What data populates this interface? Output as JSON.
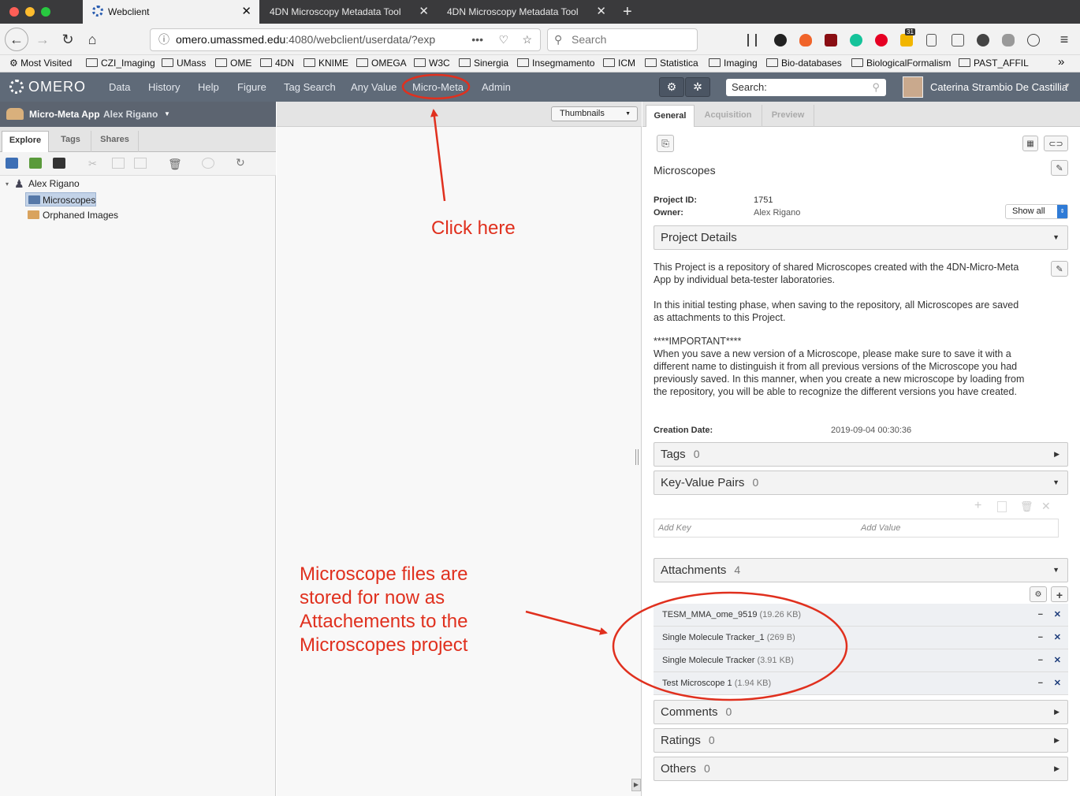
{
  "browser": {
    "tabs": [
      {
        "title": "Webclient",
        "active": true
      },
      {
        "title": "4DN Microscopy Metadata Tool",
        "active": false
      },
      {
        "title": "4DN Microscopy Metadata Tool",
        "active": false
      }
    ],
    "new_tab": "+",
    "url_host": "omero.umassmed.edu",
    "url_path": ":4080/webclient/userdata/?exp",
    "url_more": "•••",
    "search_placeholder": "Search",
    "badge_count": "31",
    "bookmarks": [
      "Most Visited",
      "CZI_Imaging",
      "UMass",
      "OME",
      "4DN",
      "KNIME",
      "OMEGA",
      "W3C",
      "Sinergia",
      "Insegmamento",
      "ICM",
      "Statistica",
      "Imaging",
      "Bio-databases",
      "BiologicalFormalism",
      "PAST_AFFIL"
    ],
    "more_bookmarks": "»"
  },
  "omero": {
    "logo": "OMERO",
    "menu": [
      "Data",
      "History",
      "Help",
      "Figure",
      "Tag Search",
      "Any Value",
      "Micro-Meta",
      "Admin"
    ],
    "search_placeholder": "Search:",
    "user_name": "Caterina Strambio De Castillia"
  },
  "left": {
    "group": "Micro-Meta App",
    "user": "Alex Rigano",
    "tabs": [
      "Explore",
      "Tags",
      "Shares"
    ],
    "tree_root": "Alex Rigano",
    "tree_items": [
      "Microscopes",
      "Orphaned Images"
    ]
  },
  "center": {
    "view_select": "Thumbnails"
  },
  "right": {
    "tabs": [
      "General",
      "Acquisition",
      "Preview"
    ],
    "title": "Microscopes",
    "project_id_label": "Project ID:",
    "project_id": "1751",
    "owner_label": "Owner:",
    "owner": "Alex Rigano",
    "show_all": "Show all",
    "details_header": "Project Details",
    "description": [
      "This Project is a repository of shared Microscopes created with the 4DN-Micro-Meta App by individual beta-tester laboratories.",
      "In this initial testing phase, when saving to the repository, all Microscopes are saved as attachments to this Project.",
      "****IMPORTANT****",
      "When you save a new version of a Microscope, please make sure to save it with a different name to distinguish it from all previous versions of the Microscope you had previously saved. In this manner, when you create a new microscope by loading from the repository, you will be able to recognize the different versions you have created."
    ],
    "creation_label": "Creation Date:",
    "creation_date": "2019-09-04 00:30:36",
    "tags": {
      "label": "Tags",
      "count": "0"
    },
    "kvp": {
      "label": "Key-Value Pairs",
      "count": "0",
      "key_placeholder": "Add Key",
      "value_placeholder": "Add Value"
    },
    "attachments": {
      "label": "Attachments",
      "count": "4",
      "items": [
        {
          "name": "TESM_MMA_ome_9519",
          "size": "(19.26 KB)"
        },
        {
          "name": "Single Molecule Tracker_1",
          "size": "(269 B)"
        },
        {
          "name": "Single Molecule Tracker",
          "size": "(3.91 KB)"
        },
        {
          "name": "Test Microscope 1",
          "size": "(1.94 KB)"
        }
      ]
    },
    "comments": {
      "label": "Comments",
      "count": "0"
    },
    "ratings": {
      "label": "Ratings",
      "count": "0"
    },
    "others": {
      "label": "Others",
      "count": "0"
    }
  },
  "annotations": {
    "click_here": "Click here",
    "note_lines": [
      "Microscope files are",
      "stored for now as",
      "Attachements to the",
      "Microscopes project"
    ],
    "color": "#e0301e"
  }
}
